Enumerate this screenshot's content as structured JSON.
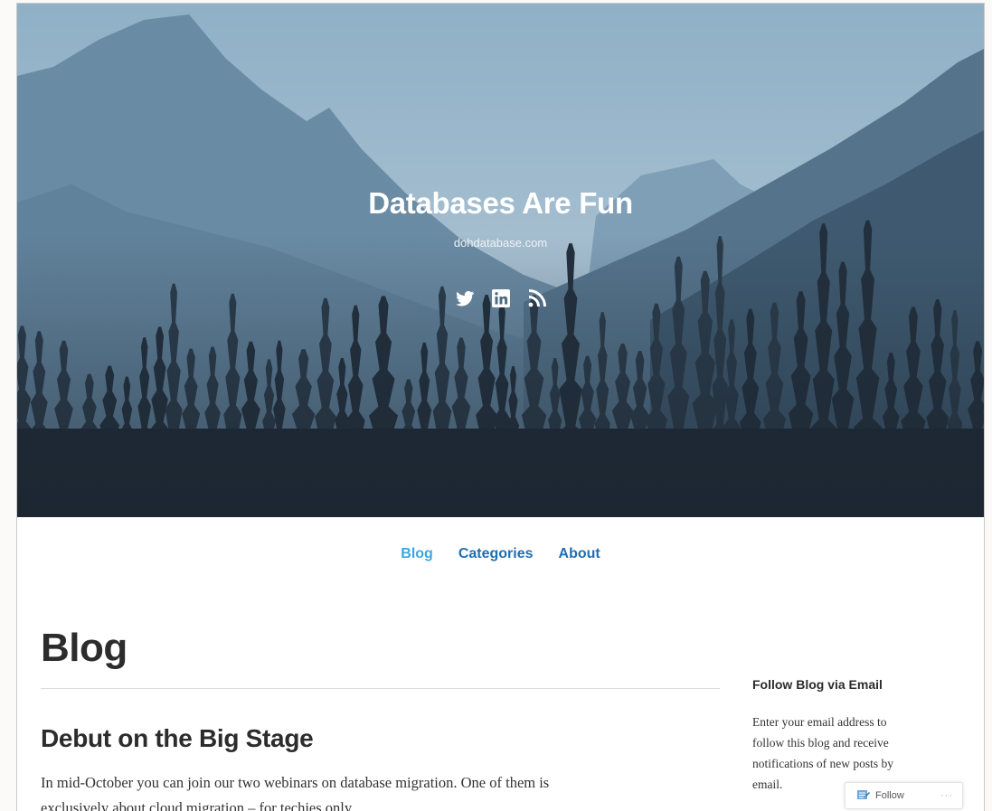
{
  "header": {
    "site_title": "Databases Are Fun",
    "site_subtitle": "dohdatabase.com",
    "social_icons": [
      "twitter-icon",
      "linkedin-icon",
      "rss-icon"
    ]
  },
  "nav": {
    "items": [
      {
        "label": "Blog",
        "active": true
      },
      {
        "label": "Categories",
        "active": false
      },
      {
        "label": "About",
        "active": false
      }
    ]
  },
  "main": {
    "page_title": "Blog",
    "post": {
      "title": "Debut on the Big Stage",
      "excerpt_line1": "In mid-October you can join our two webinars on database migration. One of them is",
      "excerpt_line2": "exclusively about cloud migration – for techies only."
    }
  },
  "sidebar": {
    "widget_title": "Follow Blog via Email",
    "lines": [
      "Enter your email address to",
      "follow this blog and receive",
      "notifications of new posts by",
      "email."
    ]
  },
  "follow_bar": {
    "follow_label": "Follow",
    "more_label": "···"
  },
  "colors": {
    "nav_active": "#3ba8e0",
    "nav_link": "#1f6fb2",
    "sky_top": "#8fb0c6",
    "forest_dark": "#1e2a36"
  }
}
